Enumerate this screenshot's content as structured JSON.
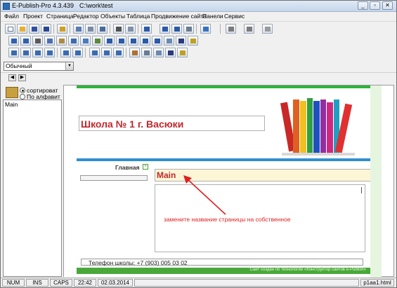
{
  "window": {
    "app_title": "E-Publish-Pro 4.3.439",
    "path": "C:\\work\\test",
    "controls": [
      "_",
      "▫",
      "✕"
    ]
  },
  "menu": [
    "Файл",
    "Проект",
    "Страница",
    "Редактор",
    "Объекты",
    "Таблица",
    "Продвижение сайта",
    "Панели",
    "Сервис"
  ],
  "toolbar": {
    "style_select": "Обычный"
  },
  "left_panel": {
    "sort_options": [
      "сортироват",
      "По алфавит"
    ],
    "selected_sort": 0,
    "pages": [
      "Main"
    ]
  },
  "page": {
    "site_title": "Школа № 1 г. Васюки",
    "nav_link": "Главная",
    "nav_plus": "+",
    "page_heading": "Main",
    "annotation": "замените название страницы на собственное",
    "phone": "Телефон школы: +7 (903) 005 03 02",
    "footer": "Сайт создан по технологии «Конструктор сайтов e-Publish»"
  },
  "status": {
    "num": "NUM",
    "ins": "INS",
    "caps": "CAPS",
    "time": "22:42",
    "date": "02.03.2014",
    "file": "p1aa1.html"
  },
  "colors": {
    "accent_red": "#c0272d",
    "green": "#2db43a",
    "blue": "#2f8fd0",
    "annotation_red": "#e02020"
  }
}
